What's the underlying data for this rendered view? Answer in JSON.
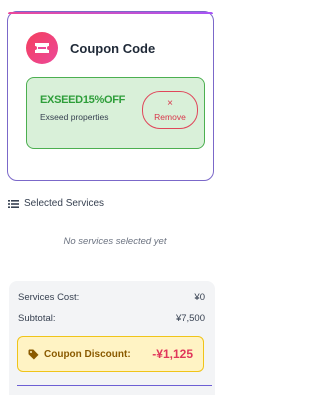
{
  "coupon": {
    "title": "Coupon Code",
    "applied_code": "EXSEED15%OFF",
    "applied_description": "Exseed properties",
    "remove_label": "Remove",
    "remove_symbol": "×"
  },
  "services": {
    "heading": "Selected Services",
    "empty_text": "No services selected yet"
  },
  "summary": {
    "services_cost_label": "Services Cost:",
    "services_cost_value": "¥0",
    "subtotal_label": "Subtotal:",
    "subtotal_value": "¥7,500",
    "discount_label": "Coupon Discount:",
    "discount_value": "-¥1,125"
  },
  "colors": {
    "accent_purple": "#7b68c9",
    "success_green": "#2e9e3a",
    "danger_red": "#d9364b",
    "discount_yellow": "#fff3c4"
  },
  "icons": {
    "coupon": "ticket-icon",
    "list": "list-icon",
    "discount": "tag-icon"
  }
}
